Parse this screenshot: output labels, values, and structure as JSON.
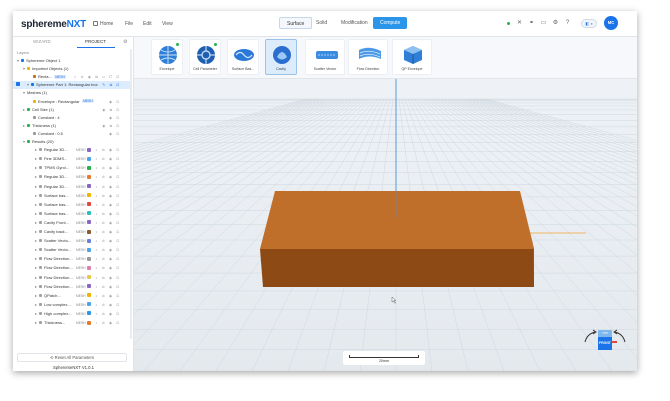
{
  "app": {
    "logo_main": "sphereme",
    "logo_accent": "NXT",
    "menu": [
      {
        "label": "Home",
        "icon": "home-icon"
      },
      {
        "label": "File"
      },
      {
        "label": "Edit"
      },
      {
        "label": "View"
      }
    ],
    "tabs": [
      {
        "label": "Surface",
        "state": "outlined"
      },
      {
        "label": "Solid",
        "state": "normal"
      },
      {
        "label": "Modification",
        "state": "normal"
      },
      {
        "label": "Compute",
        "state": "primary"
      }
    ],
    "avatar_initials": "MC",
    "accent_color": "#1a73e8",
    "compute_color": "#2b95e9"
  },
  "left_panel": {
    "tabs": [
      "WIZARD",
      "PROJECT"
    ],
    "active_tab": "PROJECT",
    "section_label": "Layers",
    "tree": [
      {
        "indent": 0,
        "arrow": "▾",
        "icon_color": "#1a73e8",
        "label": "Sphereme Object 1",
        "badge": "",
        "acts": ""
      },
      {
        "indent": 1,
        "arrow": "▾",
        "icon_color": "#f0b400",
        "label": "Imported Objects (1)",
        "badge": "",
        "acts": ""
      },
      {
        "indent": 2,
        "arrow": "",
        "icon_color": "#c46a1d",
        "label": "Recta...",
        "badge": "MESH",
        "acts": "◐ ⊘ ◉ ⧉ ▭ ⧠ ⊡"
      },
      {
        "indent": 0,
        "arrow": "▾",
        "icon_color": "#1a73e8",
        "label": "Sphereme Part 1: Rectangular box",
        "badge": "",
        "acts": "✎ ⧉ ⊡",
        "selected": true,
        "checkbox": true
      },
      {
        "indent": 1,
        "arrow": "▾",
        "icon_color": "",
        "label": "Meshes (1)",
        "badge": "",
        "acts": ""
      },
      {
        "indent": 2,
        "arrow": "",
        "icon_color": "#f0b400",
        "label": "Envelope : Rectangular",
        "badge": "MESH",
        "acts": "◉ ⊡"
      },
      {
        "indent": 1,
        "arrow": "▸",
        "icon_color": "#27b34b",
        "label": "Cell Size (1)",
        "badge": "",
        "acts": "◉ ⧉ ⊡"
      },
      {
        "indent": 2,
        "arrow": "",
        "icon_color": "#999",
        "label": "Constant : 4",
        "badge": "",
        "acts": "◉ ⊡"
      },
      {
        "indent": 1,
        "arrow": "▸",
        "icon_color": "#27b34b",
        "label": "Thickness (1)",
        "badge": "",
        "acts": "◉ ⧉ ⊡"
      },
      {
        "indent": 2,
        "arrow": "",
        "icon_color": "#999",
        "label": "Constant : 0.5",
        "badge": "",
        "acts": "◉ ⊡"
      },
      {
        "indent": 1,
        "arrow": "▾",
        "icon_color": "#27b34b",
        "label": "Results (20)",
        "badge": "",
        "acts": ""
      }
    ],
    "results": [
      {
        "label": "Regular 3D...",
        "swatch": "#8a65c6"
      },
      {
        "label": "Fine 3DMS...",
        "swatch": "#4da3e8"
      },
      {
        "label": "TPMS Gyroi...",
        "swatch": "#27b34b"
      },
      {
        "label": "Regular 3D...",
        "swatch": "#e67a2e"
      },
      {
        "label": "Regular 3D...",
        "swatch": "#8a65c6"
      },
      {
        "label": "Surface bas...",
        "swatch": "#f0b400"
      },
      {
        "label": "Surface bas...",
        "swatch": "#e2463e"
      },
      {
        "label": "Surface bas...",
        "swatch": "#2dbfbf"
      },
      {
        "label": "Cavity Front...",
        "swatch": "#8a65c6"
      },
      {
        "label": "Cavity back...",
        "swatch": "#8b5a2b"
      },
      {
        "label": "Scatter Vecto...",
        "swatch": "#6b7fd6"
      },
      {
        "label": "Scatter Vecto...",
        "swatch": "#4da3e8"
      },
      {
        "label": "Flow Direction...",
        "swatch": "#9a9a9a"
      },
      {
        "label": "Flow Direction...",
        "swatch": "#e07bb0"
      },
      {
        "label": "Flow Direction...",
        "swatch": "#e6c84a"
      },
      {
        "label": "Flow Direction...",
        "swatch": "#8a65c6"
      },
      {
        "label": "QPatch...",
        "swatch": "#f0b400"
      },
      {
        "label": "Low complex...",
        "swatch": "#4da3e8"
      },
      {
        "label": "High complex...",
        "swatch": "#2b95e9"
      },
      {
        "label": "Thickness...",
        "swatch": "#e67a2e"
      }
    ],
    "results_mesh_label": "MESH",
    "results_acts": "◐ ⊘ ◉ ⊡",
    "reset_button": "Reset All Parameters",
    "version": "SpheremeNXT V1.0.1"
  },
  "toolbar": {
    "tools": [
      {
        "label": "Envelope",
        "icon": "envelope-sphere-icon",
        "dot": true,
        "active": false
      },
      {
        "label": "Cell Parameter",
        "icon": "cell-parameter-icon",
        "dot": true,
        "active": false
      },
      {
        "label": "Surface Bas...",
        "icon": "surface-based-icon",
        "dot": false,
        "active": false
      },
      {
        "label": "Cavity",
        "icon": "cavity-icon",
        "dot": false,
        "active": true
      },
      {
        "label": "Scatter Vector",
        "icon": "scatter-vector-icon",
        "dot": false,
        "active": false
      },
      {
        "label": "Flow Direction",
        "icon": "flow-direction-icon",
        "dot": false,
        "active": false
      },
      {
        "label": "QP Envelope",
        "icon": "qp-envelope-icon",
        "dot": false,
        "active": false
      }
    ]
  },
  "viewport": {
    "background": "#e9eef3",
    "box_color_top": "#bf6f2a",
    "box_color_front": "#8e4a14",
    "scalebar_label": "20mm",
    "cube_top_label": "TOP",
    "cube_front_label": "FRONT"
  }
}
